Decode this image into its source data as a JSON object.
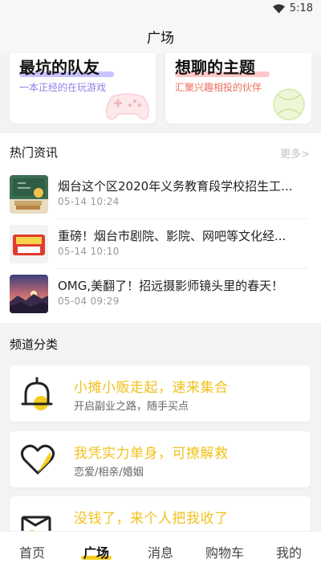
{
  "status": {
    "time": "5:18",
    "wifi_icon": "wifi-icon"
  },
  "header": {
    "title": "广场"
  },
  "top_cards": [
    {
      "title": "最坑的队友",
      "subtitle": "一本正经的在玩游戏",
      "highlight": "#c8c3ff",
      "subtitle_color": "#8b82e6"
    },
    {
      "title": "想聊的主题",
      "subtitle": "汇聚兴趣相投的伙伴",
      "highlight": "#ffc7c7",
      "subtitle_color": "#e86f5f"
    }
  ],
  "news": {
    "heading": "热门资讯",
    "more": "更多>",
    "items": [
      {
        "title": "烟台这个区2020年义务教育段学校招生工...",
        "time": "05-14 10:24"
      },
      {
        "title": "重磅！烟台市剧院、影院、网吧等文化经...",
        "time": "05-14 10:10"
      },
      {
        "title": "OMG,美翻了！招远摄影师镜头里的春天！",
        "time": "05-04 09:29"
      }
    ]
  },
  "channels": {
    "heading": "频道分类",
    "items": [
      {
        "title": "小摊小贩走起，速来集合",
        "subtitle": "开启副业之路，随手买点",
        "icon": "bell-icon"
      },
      {
        "title": "我凭实力单身，可撩解救",
        "subtitle": "恋爱/相亲/婚姻",
        "icon": "heart-icon"
      },
      {
        "title": "没钱了，来个人把我收了",
        "subtitle": "",
        "icon": "wallet-icon"
      }
    ]
  },
  "tabbar": {
    "tabs": [
      {
        "label": "首页"
      },
      {
        "label": "广场"
      },
      {
        "label": "消息"
      },
      {
        "label": "购物车"
      },
      {
        "label": "我的"
      }
    ],
    "active_index": 1,
    "accent": "#f5cd1d"
  }
}
